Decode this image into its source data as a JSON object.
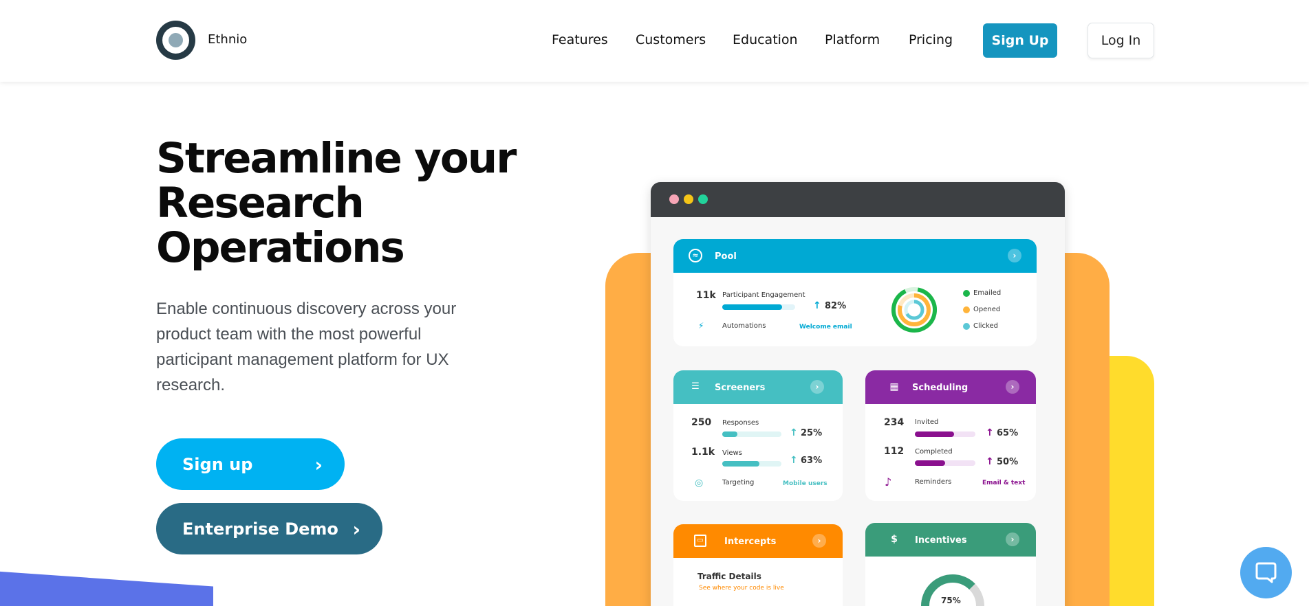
{
  "header": {
    "brand": "Ethnio",
    "nav": [
      "Features",
      "Customers",
      "Education",
      "Platform",
      "Pricing"
    ],
    "signup": "Sign Up",
    "login": "Log In"
  },
  "hero": {
    "title_lines": [
      "Streamline your",
      "Research",
      "Operations"
    ],
    "subtitle": "Enable continuous discovery across your product team with the most powerful participant management platform for UX research.",
    "cta_signup": "Sign up",
    "cta_demo": "Enterprise Demo"
  },
  "dashboard": {
    "pool": {
      "title": "Pool",
      "count": "11k",
      "engagement_label": "Participant Engagement",
      "engagement_pct": "82%",
      "engagement_fill": 0.82,
      "automations_label": "Automations",
      "automations_link": "Welcome email",
      "legend": [
        "Emailed",
        "Opened",
        "Clicked"
      ]
    },
    "screeners": {
      "title": "Screeners",
      "responses_count": "250",
      "responses_label": "Responses",
      "responses_pct": "25%",
      "responses_fill": 0.25,
      "views_count": "1.1k",
      "views_label": "Views",
      "views_pct": "63%",
      "views_fill": 0.63,
      "targeting_label": "Targeting",
      "targeting_link": "Mobile users"
    },
    "scheduling": {
      "title": "Scheduling",
      "invited_count": "234",
      "invited_label": "Invited",
      "invited_pct": "65%",
      "invited_fill": 0.65,
      "completed_count": "112",
      "completed_label": "Completed",
      "completed_pct": "50%",
      "completed_fill": 0.5,
      "reminders_label": "Reminders",
      "reminders_link": "Email & text"
    },
    "intercepts": {
      "title": "Intercepts",
      "traffic_title": "Traffic Details",
      "traffic_sub": "See where your code is live"
    },
    "incentives": {
      "title": "Incentives",
      "gauge_pct": "75%",
      "gauge_fill": 0.75
    }
  },
  "colors": {
    "pool": "#00a9d3",
    "screeners": "#45bfc2",
    "scheduling": "#8a2aa3",
    "intercepts": "#ff8a00",
    "incentives": "#3a9c7a"
  },
  "icons": {
    "chat": "chat-bubble-icon",
    "chevron": "chevron-right-icon"
  }
}
